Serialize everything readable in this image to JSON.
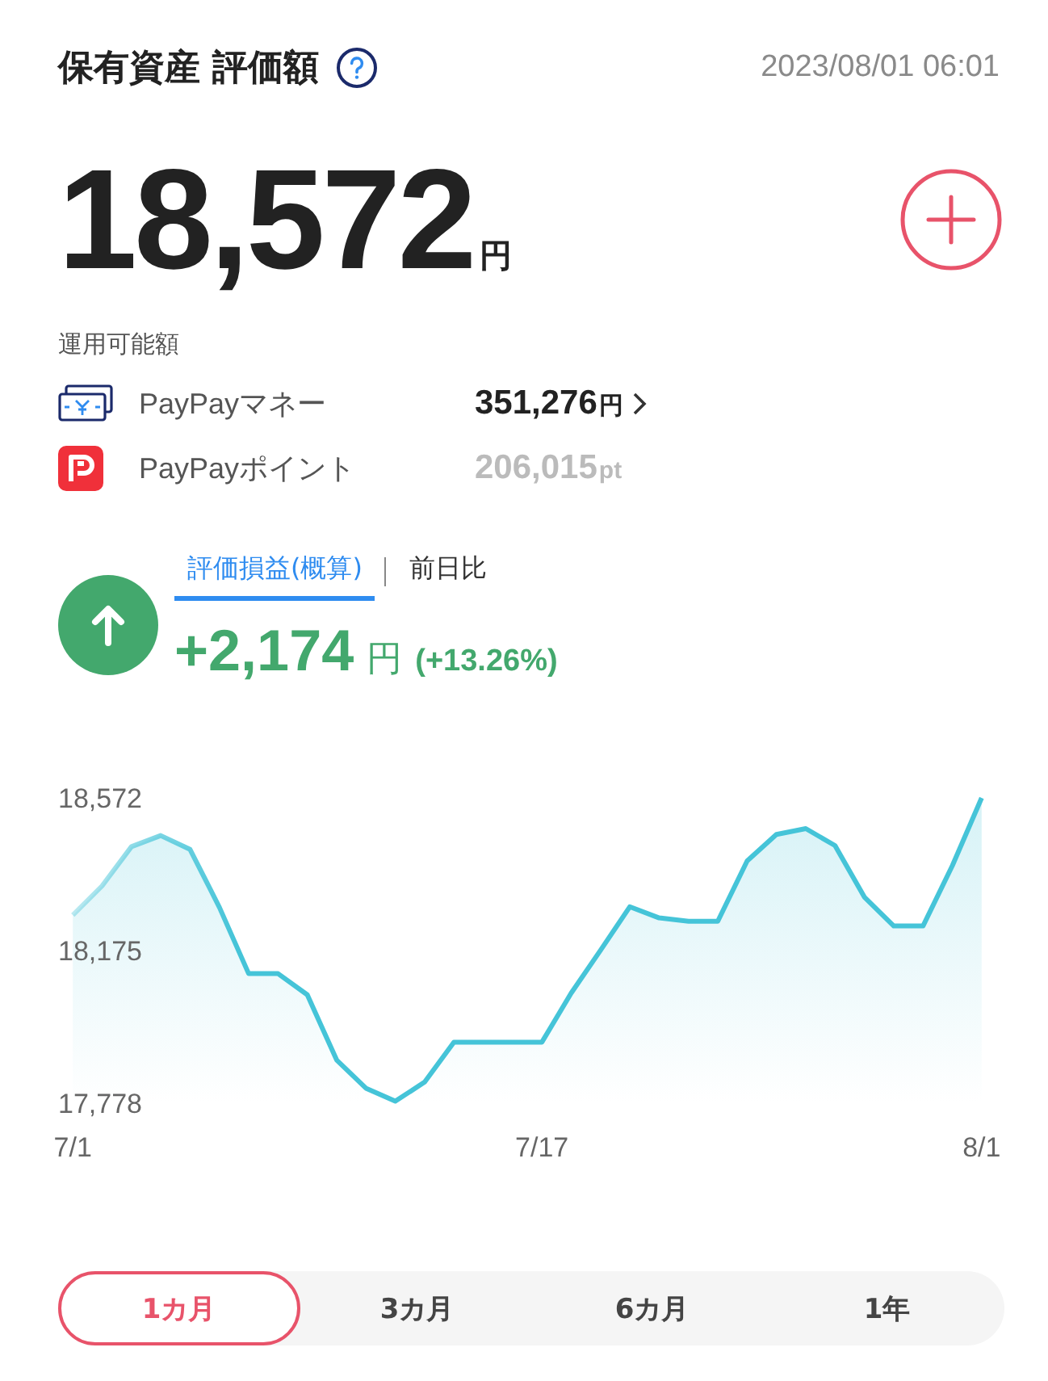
{
  "header": {
    "title": "保有資産 評価額",
    "timestamp": "2023/08/01 06:01"
  },
  "valuation": {
    "amount": "18,572",
    "unit": "円"
  },
  "available": {
    "label": "運用可能額",
    "items": [
      {
        "kind": "money",
        "name": "PayPayマネー",
        "amount": "351,276",
        "unit": "円",
        "disabled": false
      },
      {
        "kind": "points",
        "name": "PayPayポイント",
        "amount": "206,015",
        "unit": "pt",
        "disabled": true
      }
    ]
  },
  "gain": {
    "kind": "up",
    "tabs": [
      {
        "label": "評価損益(概算)",
        "selected": true
      },
      {
        "label": "前日比",
        "selected": false
      }
    ],
    "amount": "+2,174",
    "unit": "円",
    "percent": "(+13.26%)"
  },
  "chart": {
    "chart_data": {
      "type": "area",
      "categories": [
        "7/1",
        null,
        null,
        null,
        null,
        null,
        null,
        null,
        null,
        null,
        null,
        null,
        null,
        null,
        null,
        null,
        "7/17",
        null,
        null,
        null,
        null,
        null,
        null,
        null,
        null,
        null,
        null,
        null,
        null,
        null,
        null,
        "8/1"
      ],
      "series": [
        {
          "color": "#45c4d8",
          "values": [
            18267,
            18343,
            18445,
            18474,
            18438,
            18287,
            18115,
            18115,
            18060,
            17890,
            17817,
            17783,
            17833,
            17937,
            17937,
            17937,
            17937,
            18064,
            18176,
            18289,
            18260,
            18251,
            18251,
            18408,
            18477,
            18492,
            18448,
            18314,
            18239,
            18239,
            18396,
            18572
          ]
        }
      ],
      "ylim": [
        17778,
        18572
      ],
      "yticks": [
        {
          "value": 18572,
          "label": "18,572"
        },
        {
          "value": 18175,
          "label": "18,175"
        },
        {
          "value": 17778,
          "label": "17,778"
        }
      ]
    }
  },
  "periods": [
    {
      "label": "1カ月",
      "selected": true
    },
    {
      "label": "3カ月",
      "selected": false
    },
    {
      "label": "6カ月",
      "selected": false
    },
    {
      "label": "1年",
      "selected": false
    }
  ]
}
